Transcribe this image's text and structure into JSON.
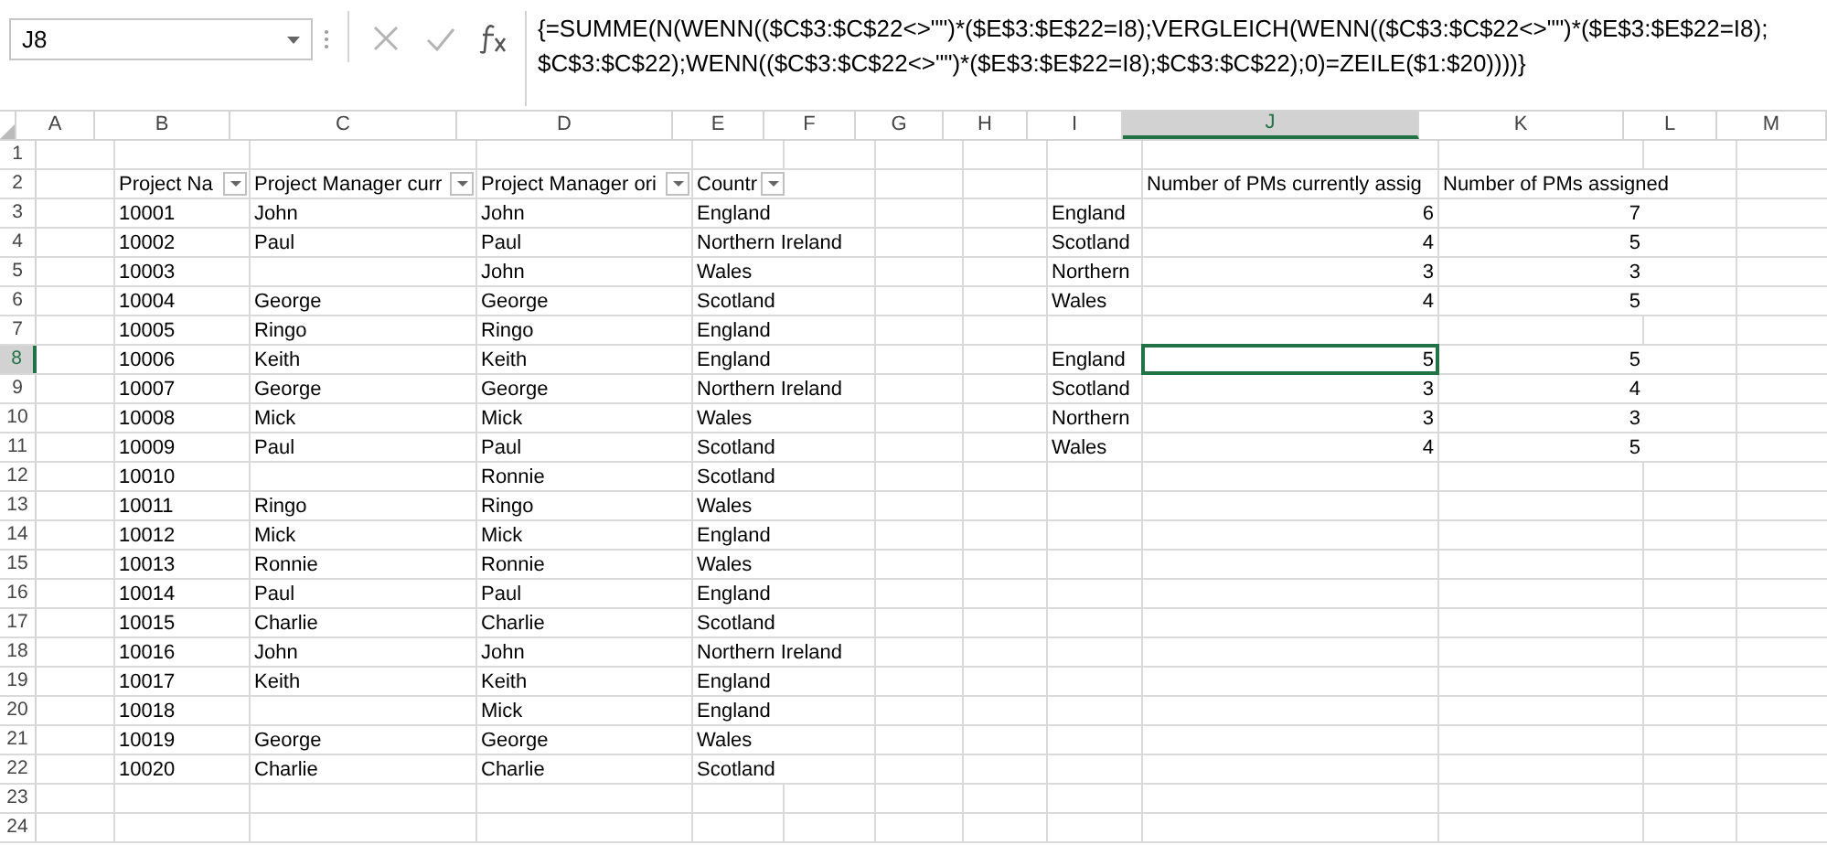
{
  "name_box": "J8",
  "formula": "{=SUMME(N(WENN(($C$3:$C$22<>\"\")*($E$3:$E$22=I8);VERGLEICH(WENN(($C$3:$C$22<>\"\")*($E$3:$E$22=I8); $C$3:$C$22);WENN(($C$3:$C$22<>\"\")*($E$3:$E$22=I8);$C$3:$C$22);0)=ZEILE($1:$20))))}",
  "columns": [
    {
      "label": "A",
      "selected": false
    },
    {
      "label": "B",
      "selected": false
    },
    {
      "label": "C",
      "selected": false
    },
    {
      "label": "D",
      "selected": false
    },
    {
      "label": "E",
      "selected": false
    },
    {
      "label": "F",
      "selected": false
    },
    {
      "label": "G",
      "selected": false
    },
    {
      "label": "H",
      "selected": false
    },
    {
      "label": "I",
      "selected": false
    },
    {
      "label": "J",
      "selected": true
    },
    {
      "label": "K",
      "selected": false
    },
    {
      "label": "L",
      "selected": false
    },
    {
      "label": "M",
      "selected": false
    }
  ],
  "rows": [
    {
      "label": "1",
      "selected": false,
      "cells": {}
    },
    {
      "label": "2",
      "selected": false,
      "cells": {
        "B": {
          "text": "Project Na",
          "filter": true,
          "selected": false
        },
        "C": {
          "text": "Project Manager curr",
          "filter": true,
          "selected": false
        },
        "D": {
          "text": "Project Manager ori",
          "filter": true,
          "selected": false
        },
        "E": {
          "text": "Countr",
          "filter": true,
          "selected": false
        },
        "J": {
          "text": "Number of PMs currently assig",
          "selected": false
        },
        "K": {
          "text": "Number of PMs assigned",
          "selected": false
        }
      }
    },
    {
      "label": "3",
      "selected": false,
      "cells": {
        "B": {
          "text": "10001",
          "selected": false
        },
        "C": {
          "text": "John",
          "selected": false
        },
        "D": {
          "text": "John",
          "selected": false
        },
        "E": {
          "text": "England",
          "selected": false
        },
        "I": {
          "text": "England",
          "selected": false
        },
        "J": {
          "text": "6",
          "kind": "number",
          "selected": false
        },
        "K": {
          "text": "7",
          "kind": "number",
          "selected": false
        }
      }
    },
    {
      "label": "4",
      "selected": false,
      "cells": {
        "B": {
          "text": "10002",
          "selected": false
        },
        "C": {
          "text": "Paul",
          "selected": false
        },
        "D": {
          "text": "Paul",
          "selected": false
        },
        "E": {
          "text": "Northern Ireland",
          "selected": false
        },
        "I": {
          "text": "Scotland",
          "selected": false
        },
        "J": {
          "text": "4",
          "kind": "number",
          "selected": false
        },
        "K": {
          "text": "5",
          "kind": "number",
          "selected": false
        }
      }
    },
    {
      "label": "5",
      "selected": false,
      "cells": {
        "B": {
          "text": "10003",
          "selected": false
        },
        "D": {
          "text": "John",
          "selected": false
        },
        "E": {
          "text": "Wales",
          "selected": false
        },
        "I": {
          "text": "Northern",
          "selected": false
        },
        "J": {
          "text": "3",
          "kind": "number",
          "selected": false
        },
        "K": {
          "text": "3",
          "kind": "number",
          "selected": false
        }
      }
    },
    {
      "label": "6",
      "selected": false,
      "cells": {
        "B": {
          "text": "10004",
          "selected": false
        },
        "C": {
          "text": "George",
          "selected": false
        },
        "D": {
          "text": "George",
          "selected": false
        },
        "E": {
          "text": "Scotland",
          "selected": false
        },
        "I": {
          "text": "Wales",
          "selected": false
        },
        "J": {
          "text": "4",
          "kind": "number",
          "selected": false
        },
        "K": {
          "text": "5",
          "kind": "number",
          "selected": false
        }
      }
    },
    {
      "label": "7",
      "selected": false,
      "cells": {
        "B": {
          "text": "10005",
          "selected": false
        },
        "C": {
          "text": "Ringo",
          "selected": false
        },
        "D": {
          "text": "Ringo",
          "selected": false
        },
        "E": {
          "text": "England",
          "selected": false
        }
      }
    },
    {
      "label": "8",
      "selected": true,
      "cells": {
        "B": {
          "text": "10006",
          "selected": false
        },
        "C": {
          "text": "Keith",
          "selected": false
        },
        "D": {
          "text": "Keith",
          "selected": false
        },
        "E": {
          "text": "England",
          "selected": false
        },
        "I": {
          "text": "England",
          "selected": false
        },
        "J": {
          "text": "5",
          "kind": "number",
          "selected": true
        },
        "K": {
          "text": "5",
          "kind": "number",
          "selected": false
        }
      }
    },
    {
      "label": "9",
      "selected": false,
      "cells": {
        "B": {
          "text": "10007",
          "selected": false
        },
        "C": {
          "text": "George",
          "selected": false
        },
        "D": {
          "text": "George",
          "selected": false
        },
        "E": {
          "text": "Northern Ireland",
          "selected": false
        },
        "I": {
          "text": "Scotland",
          "selected": false
        },
        "J": {
          "text": "3",
          "kind": "number",
          "selected": false
        },
        "K": {
          "text": "4",
          "kind": "number",
          "selected": false
        }
      }
    },
    {
      "label": "10",
      "selected": false,
      "cells": {
        "B": {
          "text": "10008",
          "selected": false
        },
        "C": {
          "text": "Mick",
          "selected": false
        },
        "D": {
          "text": "Mick",
          "selected": false
        },
        "E": {
          "text": "Wales",
          "selected": false
        },
        "I": {
          "text": "Northern",
          "selected": false
        },
        "J": {
          "text": "3",
          "kind": "number",
          "selected": false
        },
        "K": {
          "text": "3",
          "kind": "number",
          "selected": false
        }
      }
    },
    {
      "label": "11",
      "selected": false,
      "cells": {
        "B": {
          "text": "10009",
          "selected": false
        },
        "C": {
          "text": "Paul",
          "selected": false
        },
        "D": {
          "text": "Paul",
          "selected": false
        },
        "E": {
          "text": "Scotland",
          "selected": false
        },
        "I": {
          "text": "Wales",
          "selected": false
        },
        "J": {
          "text": "4",
          "kind": "number",
          "selected": false
        },
        "K": {
          "text": "5",
          "kind": "number",
          "selected": false
        }
      }
    },
    {
      "label": "12",
      "selected": false,
      "cells": {
        "B": {
          "text": "10010",
          "selected": false
        },
        "D": {
          "text": "Ronnie",
          "selected": false
        },
        "E": {
          "text": "Scotland",
          "selected": false
        }
      }
    },
    {
      "label": "13",
      "selected": false,
      "cells": {
        "B": {
          "text": "10011",
          "selected": false
        },
        "C": {
          "text": "Ringo",
          "selected": false
        },
        "D": {
          "text": "Ringo",
          "selected": false
        },
        "E": {
          "text": "Wales",
          "selected": false
        }
      }
    },
    {
      "label": "14",
      "selected": false,
      "cells": {
        "B": {
          "text": "10012",
          "selected": false
        },
        "C": {
          "text": "Mick",
          "selected": false
        },
        "D": {
          "text": "Mick",
          "selected": false
        },
        "E": {
          "text": "England",
          "selected": false
        }
      }
    },
    {
      "label": "15",
      "selected": false,
      "cells": {
        "B": {
          "text": "10013",
          "selected": false
        },
        "C": {
          "text": "Ronnie",
          "selected": false
        },
        "D": {
          "text": "Ronnie",
          "selected": false
        },
        "E": {
          "text": "Wales",
          "selected": false
        }
      }
    },
    {
      "label": "16",
      "selected": false,
      "cells": {
        "B": {
          "text": "10014",
          "selected": false
        },
        "C": {
          "text": "Paul",
          "selected": false
        },
        "D": {
          "text": "Paul",
          "selected": false
        },
        "E": {
          "text": "England",
          "selected": false
        }
      }
    },
    {
      "label": "17",
      "selected": false,
      "cells": {
        "B": {
          "text": "10015",
          "selected": false
        },
        "C": {
          "text": "Charlie",
          "selected": false
        },
        "D": {
          "text": "Charlie",
          "selected": false
        },
        "E": {
          "text": "Scotland",
          "selected": false
        }
      }
    },
    {
      "label": "18",
      "selected": false,
      "cells": {
        "B": {
          "text": "10016",
          "selected": false
        },
        "C": {
          "text": "John",
          "selected": false
        },
        "D": {
          "text": "John",
          "selected": false
        },
        "E": {
          "text": "Northern Ireland",
          "selected": false
        }
      }
    },
    {
      "label": "19",
      "selected": false,
      "cells": {
        "B": {
          "text": "10017",
          "selected": false
        },
        "C": {
          "text": "Keith",
          "selected": false
        },
        "D": {
          "text": "Keith",
          "selected": false
        },
        "E": {
          "text": "England",
          "selected": false
        }
      }
    },
    {
      "label": "20",
      "selected": false,
      "cells": {
        "B": {
          "text": "10018",
          "selected": false
        },
        "D": {
          "text": "Mick",
          "selected": false
        },
        "E": {
          "text": "England",
          "selected": false
        }
      }
    },
    {
      "label": "21",
      "selected": false,
      "cells": {
        "B": {
          "text": "10019",
          "selected": false
        },
        "C": {
          "text": "George",
          "selected": false
        },
        "D": {
          "text": "George",
          "selected": false
        },
        "E": {
          "text": "Wales",
          "selected": false
        }
      }
    },
    {
      "label": "22",
      "selected": false,
      "cells": {
        "B": {
          "text": "10020",
          "selected": false
        },
        "C": {
          "text": "Charlie",
          "selected": false
        },
        "D": {
          "text": "Charlie",
          "selected": false
        },
        "E": {
          "text": "Scotland",
          "selected": false
        }
      }
    },
    {
      "label": "23",
      "selected": false,
      "cells": {}
    },
    {
      "label": "24",
      "selected": false,
      "cells": {}
    }
  ]
}
